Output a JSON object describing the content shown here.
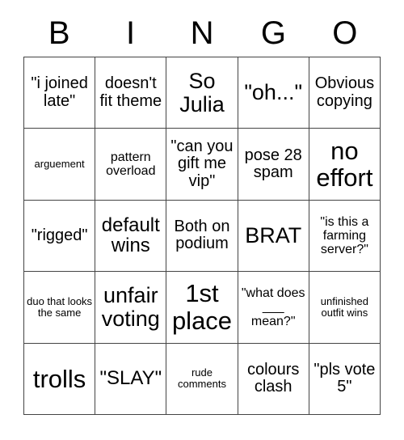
{
  "card": {
    "title": "BINGO",
    "header_letters": [
      "B",
      "I",
      "N",
      "G",
      "O"
    ],
    "columns": 5,
    "rows": 5,
    "colors": {
      "background": "#ffffff",
      "text": "#000000",
      "grid_line": "#444444"
    },
    "cells": [
      {
        "text": "\"i joined late\"",
        "size": "md"
      },
      {
        "text": "doesn't fit theme",
        "size": "md"
      },
      {
        "text": "So Julia",
        "size": "xl"
      },
      {
        "text": "\"oh...\"",
        "size": "xl"
      },
      {
        "text": "Obvious copying",
        "size": "md"
      },
      {
        "text": "arguement",
        "size": "xs"
      },
      {
        "text": "pattern overload",
        "size": "sm"
      },
      {
        "text": "\"can you gift me vip\"",
        "size": "md"
      },
      {
        "text": "pose 28 spam",
        "size": "md"
      },
      {
        "text": "no effort",
        "size": "xxl"
      },
      {
        "text": "\"rigged\"",
        "size": "md"
      },
      {
        "text": "default wins",
        "size": "lg"
      },
      {
        "text": "Both on podium",
        "size": "md"
      },
      {
        "text": "BRAT",
        "size": "xl"
      },
      {
        "text": "\"is this a farming server?\"",
        "size": "sm"
      },
      {
        "text": "duo that looks the same",
        "size": "xs"
      },
      {
        "text": "unfair voting",
        "size": "xl"
      },
      {
        "text": "1st place",
        "size": "xxl"
      },
      {
        "text": "\"what does ___ mean?\"",
        "size": "sm"
      },
      {
        "text": "unfinished outfit wins",
        "size": "xs"
      },
      {
        "text": "trolls",
        "size": "xxl"
      },
      {
        "text": "\"SLAY\"",
        "size": "lg"
      },
      {
        "text": "rude comments",
        "size": "xs"
      },
      {
        "text": "colours clash",
        "size": "md"
      },
      {
        "text": "\"pls vote 5\"",
        "size": "md"
      }
    ]
  }
}
